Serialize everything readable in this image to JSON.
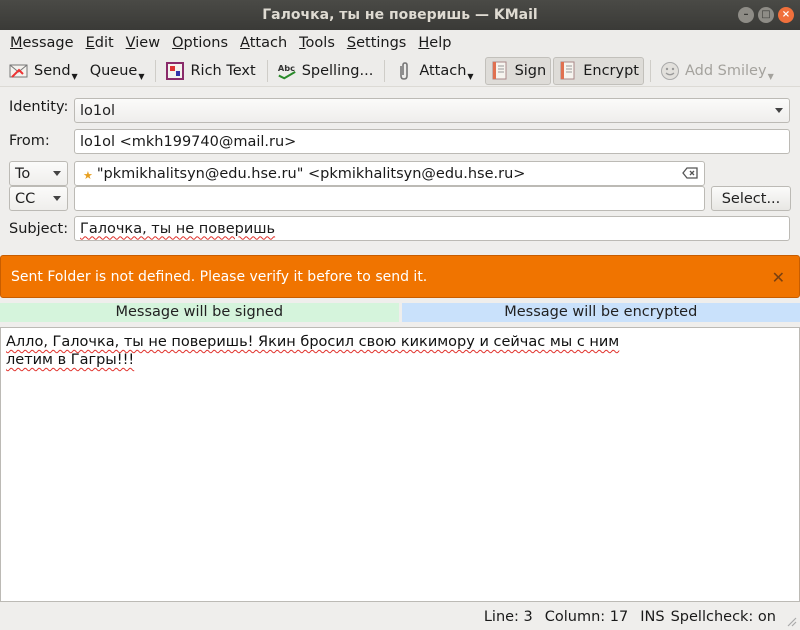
{
  "window": {
    "title": "Галочка, ты не поверишь — KMail",
    "controls": [
      "minimize",
      "maximize",
      "close"
    ]
  },
  "menubar": [
    {
      "label": "Message",
      "mnemonic": "M",
      "rest": "essage"
    },
    {
      "label": "Edit",
      "mnemonic": "E",
      "rest": "dit"
    },
    {
      "label": "View",
      "mnemonic": "V",
      "rest": "iew"
    },
    {
      "label": "Options",
      "mnemonic": "O",
      "rest": "ptions"
    },
    {
      "label": "Attach",
      "mnemonic": "A",
      "rest": "ttach"
    },
    {
      "label": "Tools",
      "mnemonic": "T",
      "rest": "ools"
    },
    {
      "label": "Settings",
      "mnemonic": "S",
      "rest": "ettings"
    },
    {
      "label": "Help",
      "mnemonic": "H",
      "rest": "elp"
    }
  ],
  "toolbar": {
    "send": "Send",
    "queue": "Queue",
    "rich_text": "Rich Text",
    "spelling": "Spelling...",
    "attach": "Attach",
    "sign": "Sign",
    "encrypt": "Encrypt",
    "add_smiley": "Add Smiley"
  },
  "form": {
    "identity_label": "Identity:",
    "identity_value": "lo1ol",
    "from_label": "From:",
    "from_value": "lo1ol <mkh199740@mail.ru>",
    "to_type": "To",
    "to_value": "\"pkmikhalitsyn@edu.hse.ru\" <pkmikhalitsyn@edu.hse.ru>",
    "cc_type": "CC",
    "cc_value": "",
    "select_button": "Select...",
    "subject_label": "Subject:",
    "subject_value": "Галочка, ты не поверишь"
  },
  "banner": {
    "message": "Sent Folder is not defined. Please verify it before to send it.",
    "color": "#f07400"
  },
  "security": {
    "signed": "Message will be signed",
    "encrypted": "Message will be encrypted",
    "signed_color": "#d5f4dc",
    "encrypted_color": "#c9e1fb"
  },
  "body": {
    "line1": "Алло, Галочка, ты не поверишь! Якин бросил свою кикимору и сейчас мы с ним",
    "line2": "летим в Гагры!!!"
  },
  "statusbar": {
    "line": "Line: 3",
    "column": "Column: 17",
    "mode": "INS",
    "spellcheck": "Spellcheck: on"
  }
}
